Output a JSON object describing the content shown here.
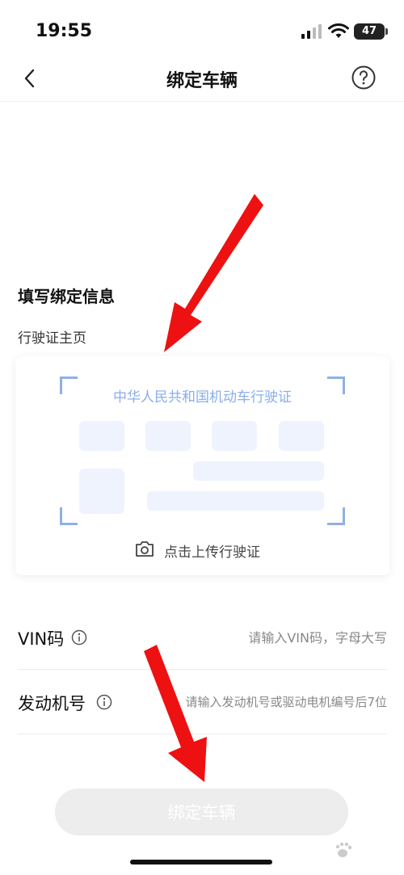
{
  "status_bar": {
    "time": "19:55",
    "battery": "47"
  },
  "nav": {
    "title": "绑定车辆"
  },
  "form": {
    "section_title": "填写绑定信息",
    "license_label": "行驶证主页",
    "license_card_title": "中华人民共和国机动车行驶证",
    "upload_label": "点击上传行驶证",
    "vin": {
      "label": "VIN码",
      "placeholder": "请输入VIN码，字母大写"
    },
    "engine": {
      "label": "发动机号",
      "placeholder": "请输入发动机号或驱动电机编号后7位"
    }
  },
  "submit_label": "绑定车辆",
  "colors": {
    "accent_light": "#8aaeea",
    "placeholder_block": "#eef3fd",
    "annotation_arrow": "#ee1111",
    "button_disabled": "#ededed"
  }
}
